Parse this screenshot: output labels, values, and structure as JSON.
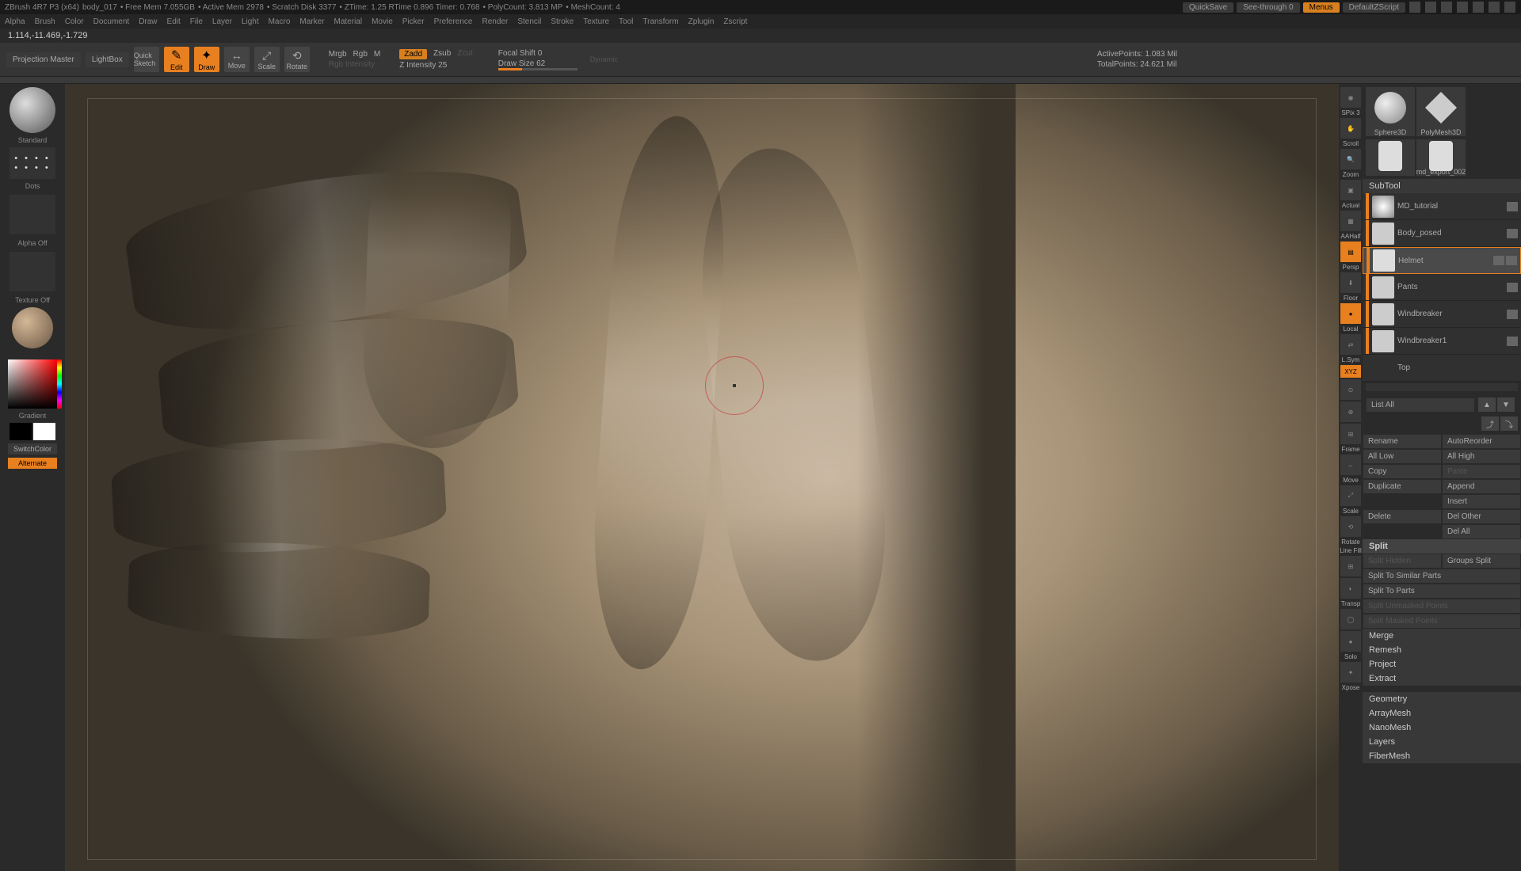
{
  "titlebar": {
    "app": "ZBrush 4R7 P3 (x64)",
    "doc": "body_017",
    "stats": [
      "Free Mem 7.055GB",
      "Active Mem 2978",
      "Scratch Disk 3377",
      "ZTime: 1.25  RTime 0.896  Timer: 0.768",
      "PolyCount: 3.813 MP",
      "MeshCount: 4"
    ],
    "quicksave": "QuickSave",
    "seethrough": "See-through   0",
    "menus": "Menus",
    "zscript": "DefaultZScript"
  },
  "menubar": [
    "Alpha",
    "Brush",
    "Color",
    "Document",
    "Draw",
    "Edit",
    "File",
    "Layer",
    "Light",
    "Macro",
    "Marker",
    "Material",
    "Movie",
    "Picker",
    "Preference",
    "Render",
    "Stencil",
    "Stroke",
    "Texture",
    "Tool",
    "Transform",
    "Zplugin",
    "Zscript"
  ],
  "coords": "1.114,-11.469,-1.729",
  "toolbar": {
    "projection": "Projection Master",
    "lightbox": "LightBox",
    "quicksketch": "Quick Sketch",
    "edit": "Edit",
    "draw": "Draw",
    "move": "Move",
    "scale": "Scale",
    "rotate": "Rotate",
    "mrgb": "Mrgb",
    "rgb": "Rgb",
    "m": "M",
    "rgbint": "Rgb Intensity",
    "zadd": "Zadd",
    "zsub": "Zsub",
    "zcut": "Zcut",
    "zint_label": "Z Intensity",
    "zint_val": "25",
    "focal_label": "Focal Shift",
    "focal_val": "0",
    "draw_label": "Draw Size",
    "draw_val": "62",
    "dynamic": "Dynamic",
    "active_pts": "ActivePoints: 1.083 Mil",
    "total_pts": "TotalPoints: 24.621 Mil"
  },
  "left": {
    "standard": "Standard",
    "dots": "Dots",
    "alpha": "Alpha Off",
    "texture": "Texture Off",
    "gradient": "Gradient",
    "switchcolor": "SwitchColor",
    "alternate": "Alternate"
  },
  "nav": {
    "spix": "SPix 3",
    "scroll": "Scroll",
    "zoom": "Zoom",
    "actual": "Actual",
    "aahalf": "AAHalf",
    "persp": "Persp",
    "floor": "Floor",
    "local": "Local",
    "lsym": "L.Sym",
    "xyz": "XYZ",
    "frame": "Frame",
    "move": "Move",
    "scale": "Scale",
    "rotate": "Rotate",
    "linefill": "Line Fill",
    "transp": "Transp",
    "solo": "Solo",
    "xpose": "Xpose"
  },
  "tools": {
    "sphere": "Sphere3D",
    "polymesh": "PolyMesh3D",
    "mdexport": "md_export_002"
  },
  "subtool": {
    "title": "SubTool",
    "items": [
      {
        "name": "MD_tutorial"
      },
      {
        "name": "Body_posed"
      },
      {
        "name": "Helmet"
      },
      {
        "name": "Pants"
      },
      {
        "name": "Windbreaker"
      },
      {
        "name": "Windbreaker1"
      },
      {
        "name": "Top"
      }
    ],
    "listall": "List All",
    "rename": "Rename",
    "autoreorder": "AutoReorder",
    "alllow": "All Low",
    "allhigh": "All High",
    "copy": "Copy",
    "paste": "Paste",
    "duplicate": "Duplicate",
    "append": "Append",
    "insert": "Insert",
    "delete": "Delete",
    "delother": "Del Other",
    "delall": "Del All",
    "split": "Split",
    "splithidden": "Split Hidden",
    "groupssplit": "Groups Split",
    "splitsimilar": "Split To Similar Parts",
    "splitparts": "Split To Parts",
    "splitunmasked": "Split Unmasked Points",
    "splitmasked": "Split Masked Points",
    "merge": "Merge",
    "remesh": "Remesh",
    "project": "Project",
    "extract": "Extract",
    "geometry": "Geometry",
    "arraymesh": "ArrayMesh",
    "nanomesh": "NanoMesh",
    "layers": "Layers",
    "fibermesh": "FiberMesh"
  }
}
